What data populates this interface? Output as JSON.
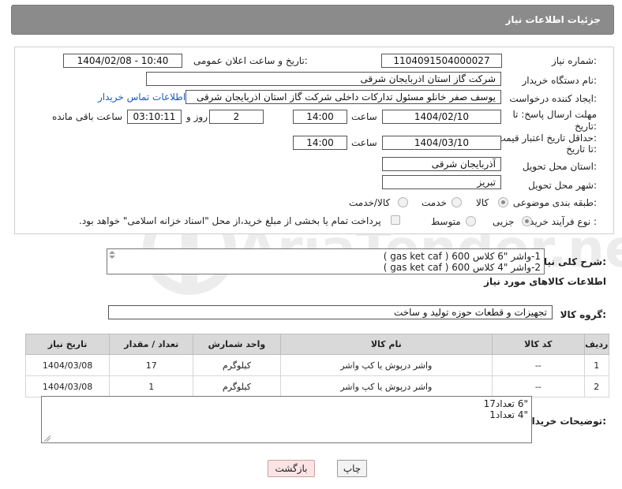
{
  "header": {
    "title": "جزئیات اطلاعات نیاز"
  },
  "form": {
    "need_number_label": "شماره نیاز:",
    "need_number": "1104091504000027",
    "announce_label": "تاریخ و ساعت اعلان عمومی:",
    "announce_value": "1404/02/08 - 10:40",
    "buyer_org_label": "نام دستگاه خریدار:",
    "buyer_org": "شرکت گاز استان اذربایجان شرقی",
    "creator_label": "ایجاد کننده درخواست:",
    "creator": "یوسف صفر خانلو  مسئول تدارکات داخلی  شرکت گاز استان اذربایجان شرقی",
    "buyer_contact_link": "اطلاعات تماس خریدار",
    "reply_deadline_label_1": "مهلت ارسال پاسخ: تا",
    "reply_deadline_label_2": "تاریخ:",
    "reply_date": "1404/02/10",
    "time_label": "ساعت",
    "reply_time": "14:00",
    "days_value": "2",
    "days_label": "روز و",
    "remaining_time": "03:10:11",
    "remaining_label": "ساعت باقی مانده",
    "price_validity_label_1": "حداقل تاریخ اعتبار قیمت:",
    "price_validity_label_2": "تا تاریخ:",
    "price_date": "1404/03/10",
    "price_time_label": "ساعت",
    "price_time": "14:00",
    "province_label": "استان محل تحویل:",
    "province": "آذربایجان شرقی",
    "city_label": "شهر محل تحویل:",
    "city": "تبریز",
    "category_label": "طبقه بندی موضوعی:",
    "category_options": [
      "کالا",
      "خدمت",
      "کالا/خدمت"
    ],
    "process_label": "نوع فرآیند خرید :",
    "process_options": [
      "جزیی",
      "متوسط"
    ],
    "payment_note": "پرداخت تمام یا بخشی از مبلغ خرید،از محل \"اسناد خزانه اسلامی\" خواهد بود."
  },
  "description": {
    "label": "شرح کلی نیاز:",
    "line1": "1-واشر \"6 کلاس 600  ( gas ket caf )",
    "line2": "2-واشر \"4 کلاس 600  ( gas ket caf )"
  },
  "goods_info": {
    "title": "اطلاعات کالاهای مورد نیاز",
    "group_label": "گروه کالا:",
    "group_value": "تجهیزات و قطعات حوزه تولید و ساخت"
  },
  "table": {
    "headers": [
      "ردیف",
      "کد کالا",
      "نام کالا",
      "واحد شمارش",
      "تعداد / مقدار",
      "تاریخ نیاز"
    ],
    "rows": [
      {
        "row": "1",
        "code": "--",
        "name": "واشر درپوش یا کپ واشر",
        "unit": "کیلوگرم",
        "qty": "17",
        "date": "1404/03/08"
      },
      {
        "row": "2",
        "code": "--",
        "name": "واشر درپوش یا کپ واشر",
        "unit": "کیلوگرم",
        "qty": "1",
        "date": "1404/03/08"
      }
    ]
  },
  "buyer_notes": {
    "label": "توضیحات خریدار:",
    "line1": "\"6 تعداد17",
    "line2": "\"4 تعداد1"
  },
  "buttons": {
    "print": "چاپ",
    "back": "بازگشت"
  },
  "watermark": {
    "text": "AriaTender.neT"
  },
  "colors": {
    "header_bg": "#8b8b8b",
    "back_button_bg": "#fce4e4",
    "link": "#1a5ab8"
  }
}
